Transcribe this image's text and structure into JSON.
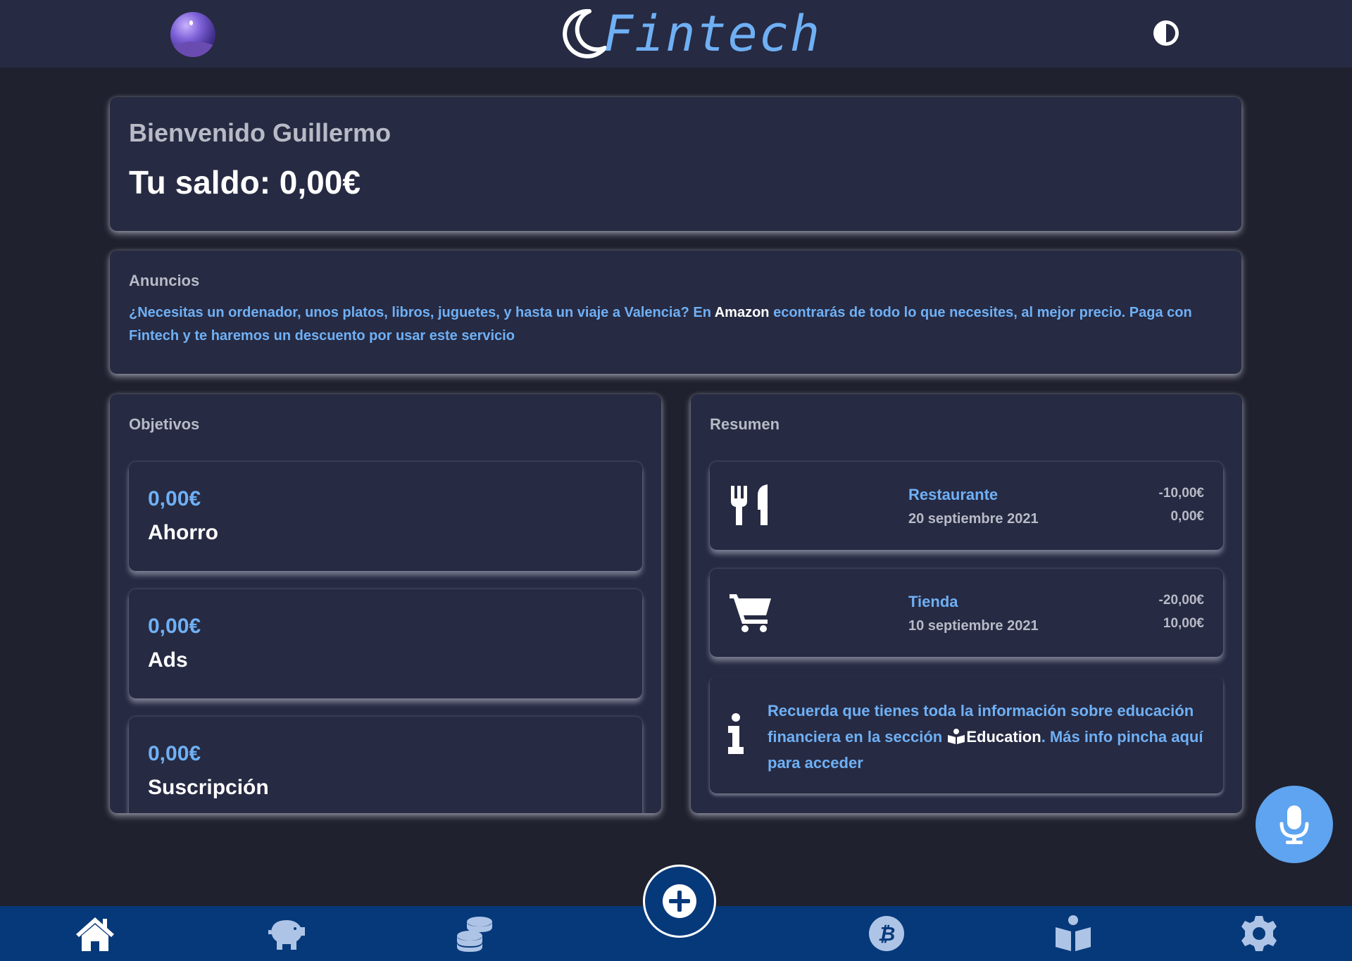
{
  "header": {
    "logo_text": "Fintech",
    "avatar_icon": "night-sky-avatar",
    "theme_icon": "contrast-icon"
  },
  "welcome": {
    "greeting": "Bienvenido Guillermo",
    "balance": "Tu saldo: 0,00€"
  },
  "ads": {
    "title": "Anuncios",
    "text_before": "¿Necesitas un ordenador, unos platos, libros, juguetes, y hasta un viaje a Valencia? En ",
    "brand": "Amazon",
    "text_after": " econtrarás de todo lo que necesites, al mejor precio. Paga con Fintech y te haremos un descuento por usar este servicio"
  },
  "goals": {
    "title": "Objetivos",
    "items": [
      {
        "amount": "0,00€",
        "label": "Ahorro"
      },
      {
        "amount": "0,00€",
        "label": "Ads"
      },
      {
        "amount": "0,00€",
        "label": "Suscripción"
      }
    ]
  },
  "summary": {
    "title": "Resumen",
    "transactions": [
      {
        "icon": "utensils-icon",
        "name": "Restaurante",
        "date": "20 septiembre 2021",
        "amount": "-10,00€",
        "balance": "0,00€"
      },
      {
        "icon": "cart-icon",
        "name": "Tienda",
        "date": "10 septiembre 2021",
        "amount": "-20,00€",
        "balance": "10,00€"
      }
    ],
    "info": {
      "text_before": "Recuerda que tienes toda la información sobre educación financiera en la sección ",
      "section": "Education",
      "text_after": ". Más info pincha aquí para acceder"
    }
  },
  "nav": {
    "items": [
      "home-icon",
      "piggy-bank-icon",
      "coins-icon",
      "plus-icon",
      "bitcoin-icon",
      "book-reader-icon",
      "gear-icon"
    ]
  },
  "colors": {
    "background": "#1f212e",
    "card": "#262a42",
    "accent": "#6fb0f5",
    "nav": "#06397a",
    "mic": "#5ea4f0"
  }
}
